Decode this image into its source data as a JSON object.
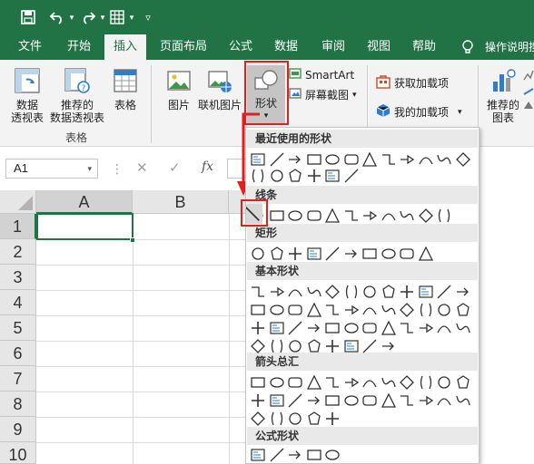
{
  "colors": {
    "accent": "#217346",
    "highlight": "#e02020"
  },
  "quick_access": [
    "save-icon",
    "undo-icon",
    "redo-icon",
    "table-grid-icon",
    "customize-icon"
  ],
  "tabs": [
    {
      "label": "文件",
      "active": false
    },
    {
      "label": "开始",
      "active": false
    },
    {
      "label": "插入",
      "active": true
    },
    {
      "label": "页面布局",
      "active": false
    },
    {
      "label": "公式",
      "active": false
    },
    {
      "label": "数据",
      "active": false
    },
    {
      "label": "审阅",
      "active": false
    },
    {
      "label": "视图",
      "active": false
    },
    {
      "label": "帮助",
      "active": false
    }
  ],
  "tell_me": "操作说明搜",
  "ribbon": {
    "pivot_table": "数据\n透视表",
    "recommended_pivot": "推荐的\n数据透视表",
    "table": "表格",
    "group_tables": "表格",
    "picture": "图片",
    "online_picture": "联机图片",
    "shapes": "形状",
    "smartart": "SmartArt",
    "screenshot": "屏幕截图",
    "get_addins": "获取加载项",
    "my_addins": "我的加载项",
    "recommended_charts": "推荐的\n图表"
  },
  "formula_bar": {
    "cell_ref": "A1",
    "fx": "fx"
  },
  "grid": {
    "columns": [
      "A",
      "B"
    ],
    "rows": [
      "1",
      "2",
      "3",
      "4",
      "5",
      "6",
      "7",
      "8",
      "9",
      "10"
    ]
  },
  "shapes_panel": {
    "categories": [
      "最近使用的形状",
      "线条",
      "矩形",
      "基本形状",
      "箭头总汇",
      "公式形状"
    ]
  }
}
